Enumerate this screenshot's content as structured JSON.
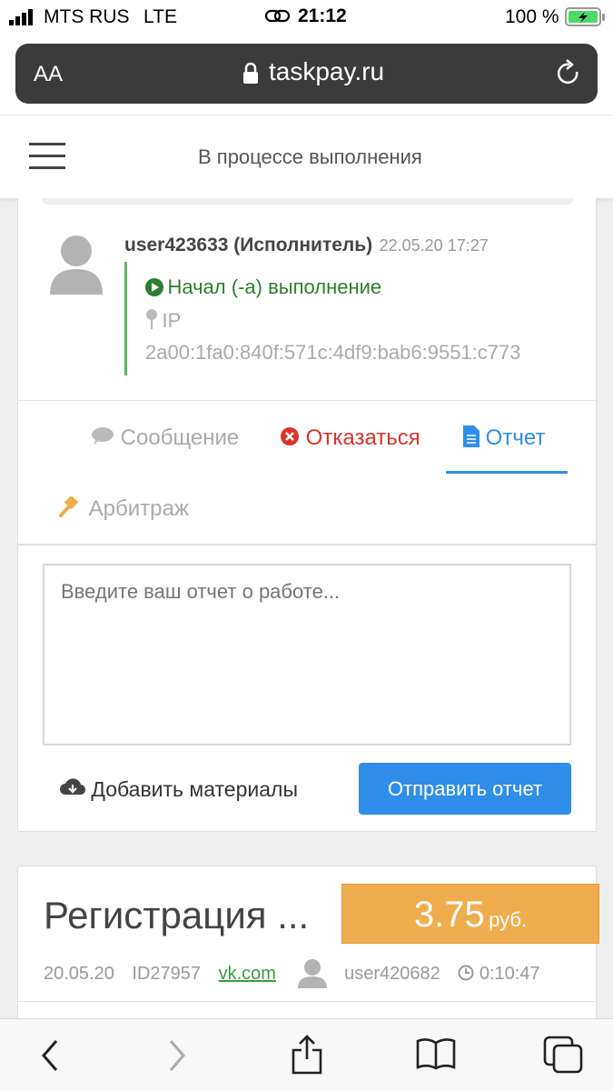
{
  "status_bar": {
    "carrier": "MTS RUS",
    "network": "LTE",
    "time": "21:12",
    "battery": "100 %"
  },
  "browser": {
    "text_size_label": "AA",
    "url": "taskpay.ru"
  },
  "header": {
    "title": "В процессе выполнения"
  },
  "history": {
    "username": "user423633 (Исполнитель)",
    "datetime": "22.05.20 17:27",
    "action": "Начал (-а) выполнение",
    "ip_label": "IP",
    "ip_value": "2a00:1fa0:840f:571c:4df9:bab6:9551:c773"
  },
  "tabs": {
    "message": "Сообщение",
    "refuse": "Отказаться",
    "report": "Отчет",
    "arbitration": "Арбитраж"
  },
  "report_form": {
    "placeholder": "Введите ваш отчет о работе...",
    "add_materials": "Добавить материалы",
    "submit": "Отправить отчет"
  },
  "task": {
    "title": "Регистрация ...",
    "price": "3.75",
    "currency": "руб.",
    "date": "20.05.20",
    "id": "ID27957",
    "site": "vk.com",
    "owner": "user420682",
    "timer": "0:10:47"
  },
  "colors": {
    "accent_blue": "#2f8ee9",
    "danger_red": "#d9342b",
    "success_green": "#2e7d32",
    "price_orange": "#f0ad4e",
    "link_green": "#3a9d3a"
  }
}
